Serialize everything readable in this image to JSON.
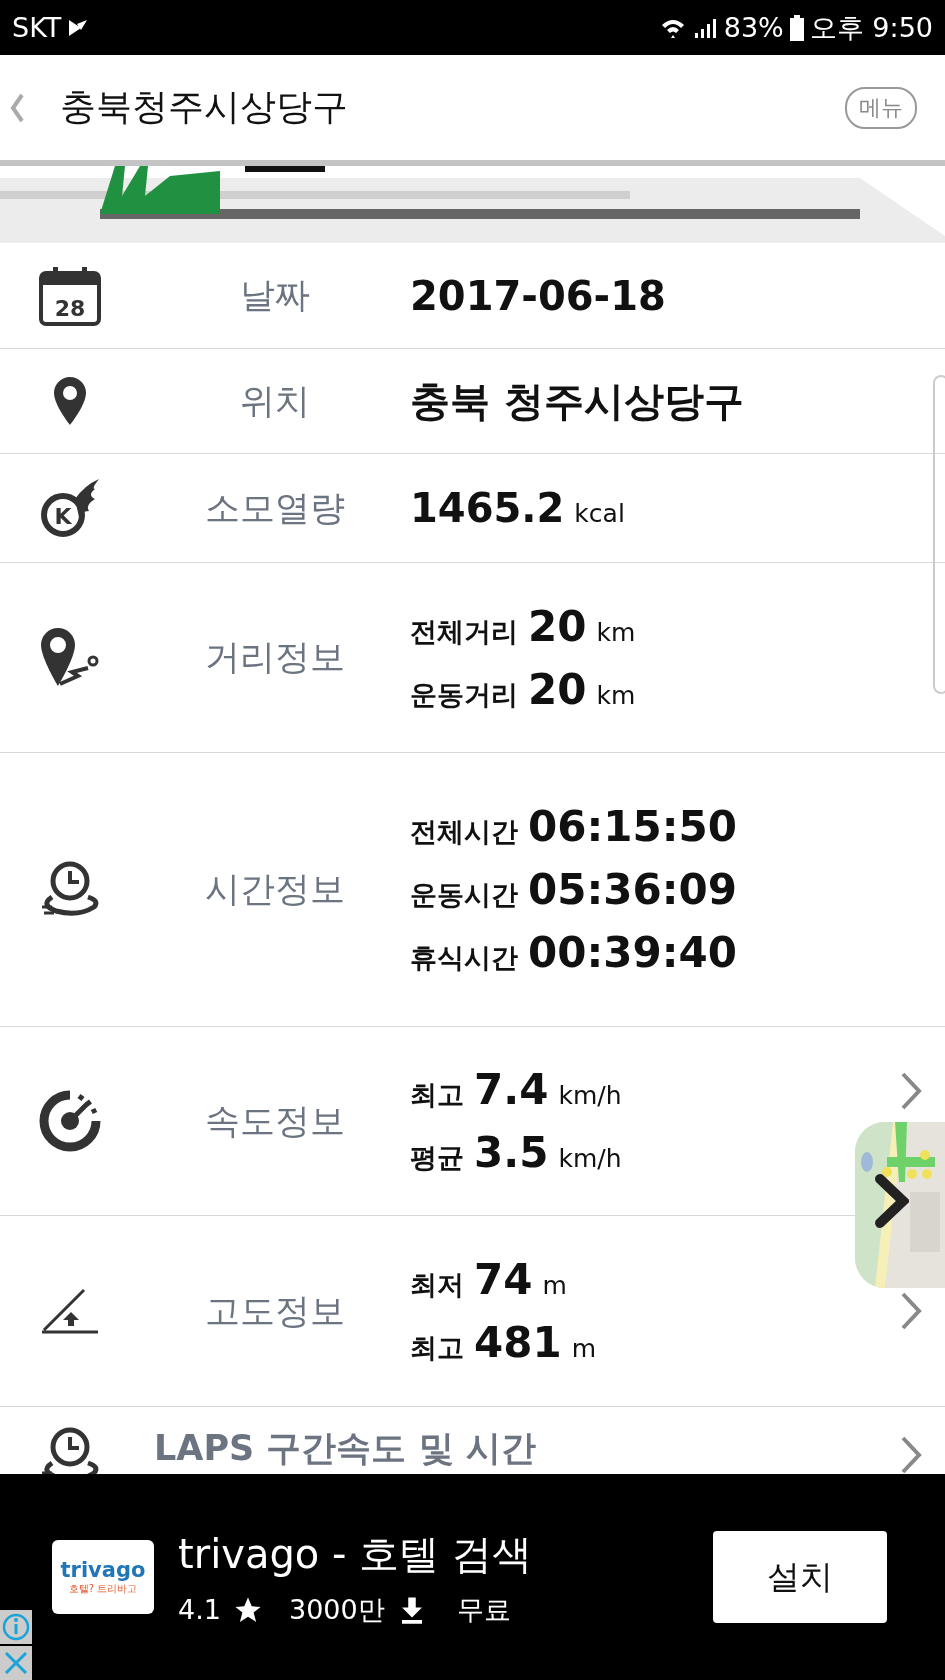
{
  "status_bar": {
    "carrier": "SKT",
    "battery": "83%",
    "time": "오후 9:50"
  },
  "app_bar": {
    "title": "충북청주시상당구",
    "menu_button": "메뉴"
  },
  "rows": [
    {
      "kind": "single",
      "label": "날짜",
      "icon_text": "28",
      "value": "2017-06-18",
      "has_arrow": false
    },
    {
      "kind": "single",
      "label": "위치",
      "value": "충북 청주시상당구",
      "has_arrow": false
    },
    {
      "kind": "single",
      "label": "소모열량",
      "icon_text": "K",
      "value": "1465.2",
      "unit": "kcal",
      "has_arrow": false
    },
    {
      "kind": "multi",
      "label": "거리정보",
      "has_arrow": false,
      "lines": [
        {
          "name": "전체거리",
          "value": "20",
          "unit": "km"
        },
        {
          "name": "운동거리",
          "value": "20",
          "unit": "km"
        }
      ]
    },
    {
      "kind": "multi",
      "label": "시간정보",
      "has_arrow": false,
      "lines": [
        {
          "name": "전체시간",
          "value": "06:15:50"
        },
        {
          "name": "운동시간",
          "value": "05:36:09"
        },
        {
          "name": "휴식시간",
          "value": "00:39:40"
        }
      ]
    },
    {
      "kind": "multi",
      "label": "속도정보",
      "has_arrow": true,
      "lines": [
        {
          "name": "최고",
          "value": "7.4",
          "unit": "km/h"
        },
        {
          "name": "평균",
          "value": "3.5",
          "unit": "km/h"
        }
      ]
    },
    {
      "kind": "multi",
      "label": "고도정보",
      "has_arrow": true,
      "lines": [
        {
          "name": "최저",
          "value": "74",
          "unit": "m"
        },
        {
          "name": "최고",
          "value": "481",
          "unit": "m"
        }
      ]
    },
    {
      "kind": "header",
      "label": "LAPS 구간속도 및 시간",
      "has_arrow": true
    }
  ],
  "ad": {
    "logo_text": "trivago",
    "logo_subtext": "호텔? 트리바고",
    "title": "trivago - 호텔 검색",
    "rating": "4.1",
    "downloads": "3000만",
    "price": "무료",
    "install_button": "설치"
  }
}
